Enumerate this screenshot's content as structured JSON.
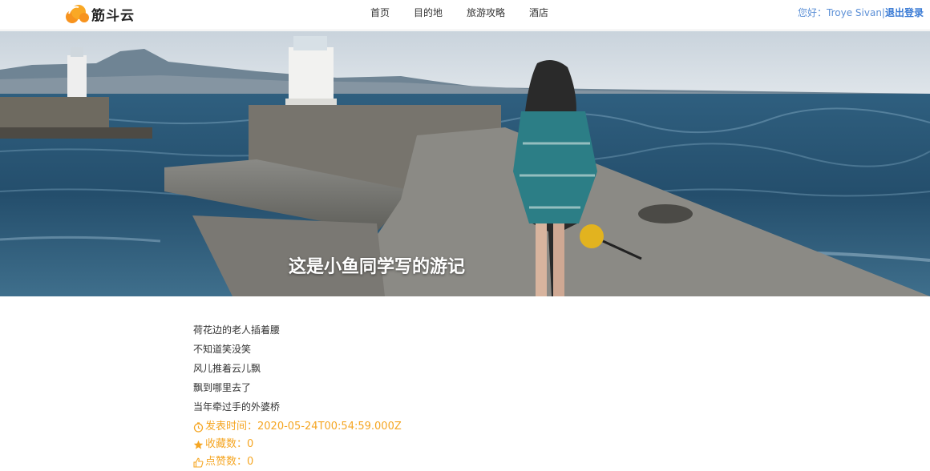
{
  "header": {
    "logo_text": "筋斗云",
    "nav": [
      "首页",
      "目的地",
      "旅游攻略",
      "酒店"
    ],
    "greeting": "您好：Troye Sivan|",
    "logout": "退出登录"
  },
  "banner": {
    "title": "这是小鱼同学写的游记"
  },
  "article": {
    "lines": [
      "荷花边的老人插着腰",
      "不知道笑没笑",
      "风儿推着云儿飘",
      "飘到哪里去了",
      "当年牵过手的外婆桥"
    ],
    "publish_label": "发表时间：",
    "publish_time": "2020-05-24T00:54:59.000Z",
    "fav_label": "收藏数：",
    "fav_count": "0",
    "like_label": "点赞数：",
    "like_count": "0"
  },
  "colors": {
    "accent": "#f5a623",
    "link": "#3a7bd5"
  }
}
